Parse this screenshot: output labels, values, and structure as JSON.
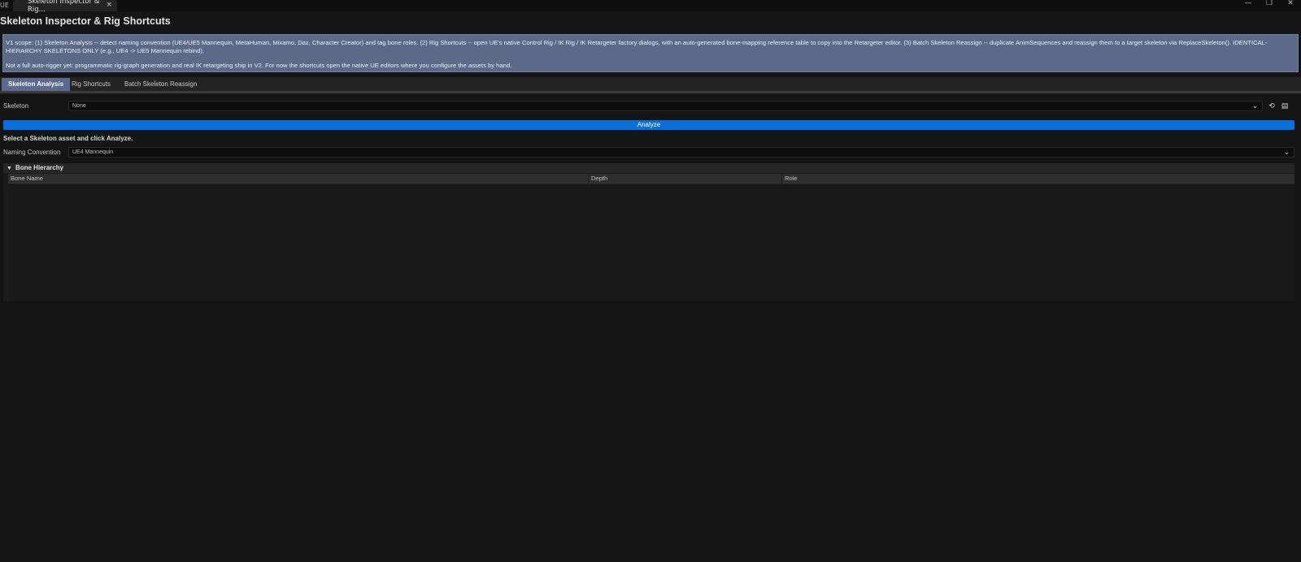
{
  "window": {
    "logo": "UE",
    "tab_title": "Skeleton Inspector & Rig...",
    "tab_close": "×",
    "minimize": "—",
    "restore": "❐",
    "close": "✕"
  },
  "page": {
    "title": "Skeleton Inspector & Rig Shortcuts"
  },
  "banner": {
    "line1": "V1 scope: (1) Skeleton Analysis -- detect naming convention (UE4/UE5 Mannequin, MetaHuman, Mixamo, Daz, Character Creator) and tag bone roles. (2) Rig Shortcuts -- open UE's native Control Rig / IK Rig / IK Retargeter factory dialogs, with an auto-generated bone-mapping reference table to copy into the Retargeter editor. (3) Batch Skeleton Reassign -- duplicate AnimSequences and reassign them to a target skeleton via ReplaceSkeleton(). IDENTICAL-HIERARCHY SKELETONS ONLY (e.g., UE4 -> UE5 Mannequin rebind).",
    "line2": "Not a full auto-rigger yet: programmatic rig-graph generation and real IK retargeting ship in V2. For now the shortcuts open the native UE editors where you configure the assets by hand."
  },
  "tabs": [
    {
      "label": "Skeleton Analysis",
      "active": true
    },
    {
      "label": "Rig Shortcuts",
      "active": false
    },
    {
      "label": "Batch Skeleton Reassign",
      "active": false
    }
  ],
  "skeleton": {
    "label": "Skeleton",
    "value": "None",
    "chevron": "⌄",
    "use_selected_icon": "⟲",
    "browse_icon": "▤"
  },
  "analyze": {
    "label": "Analyze"
  },
  "status": "Select a Skeleton asset and click Analyze.",
  "naming": {
    "label": "Naming Convention",
    "value": "UE4 Mannequin",
    "chevron": "⌄"
  },
  "bone_hierarchy": {
    "title": "Bone Hierarchy",
    "columns": [
      "Bone Name",
      "Depth",
      "Role"
    ],
    "rows": []
  }
}
